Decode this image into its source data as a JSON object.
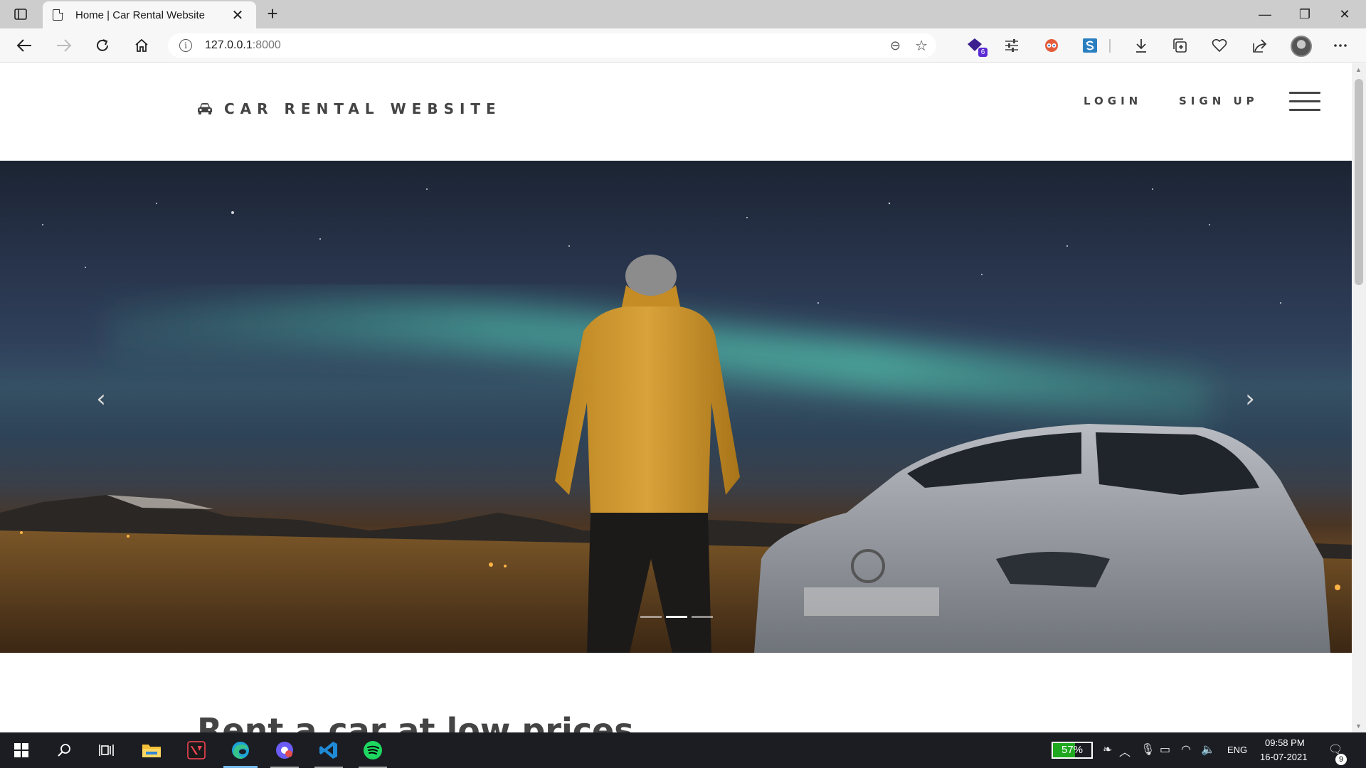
{
  "browser": {
    "tab_title": "Home | Car Rental Website",
    "tab_close": "✕",
    "new_tab": "+",
    "url_host": "127.0.0.1",
    "url_port": ":8000",
    "extension_badge": "6",
    "window_controls": {
      "minimize": "—",
      "restore": "❐",
      "close": "✕"
    }
  },
  "site": {
    "brand": "CAR RENTAL WEBSITE",
    "nav": {
      "login": "LOGIN",
      "signup": "SIGN UP"
    },
    "carousel": {
      "prev": "‹",
      "next": "›",
      "slide_count": 3,
      "active_slide": 2
    },
    "section_title": "Rent a car at low prices"
  },
  "taskbar": {
    "battery_percent": "57%",
    "battery_level": 0.57,
    "language": "ENG",
    "time": "09:58 PM",
    "date": "16-07-2021",
    "notification_count": "9"
  },
  "colors": {
    "brand_text": "#444444",
    "tab_bar": "#cdcdcd",
    "taskbar": "#1b1d23",
    "battery_fill": "#1fa81f",
    "edge_active_indicator": "#76b9ed"
  }
}
